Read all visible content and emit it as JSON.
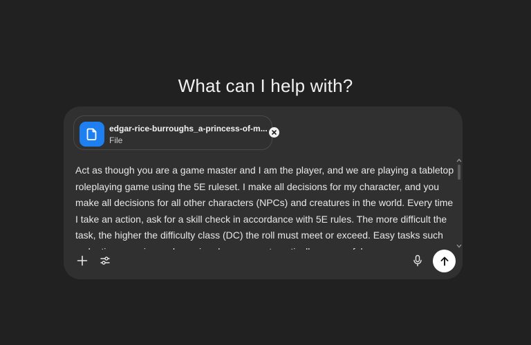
{
  "heading": "What can I help with?",
  "attachment": {
    "name": "edgar-rice-burroughs_a-princess-of-m...",
    "type": "File",
    "icon": "document-icon"
  },
  "prompt": {
    "value": "Act as though you are a game master and I am the player, and we are playing a tabletop roleplaying game using the 5E ruleset. I make all decisions for my character, and you make all decisions for all other characters (NPCs) and creatures in the world. Every time I take an action, ask for a skill check in accordance with 5E rules. The more difficult the task, the higher the difficulty class (DC) the roll must meet or exceed. Easy tasks such as looting enemies and opening doors are automatically successful."
  },
  "toolbar": {
    "add_icon": "plus-icon",
    "tools_icon": "sliders-icon",
    "voice_icon": "microphone-icon",
    "send_icon": "arrow-up-icon"
  },
  "colors": {
    "background": "#212121",
    "composer": "#303030",
    "file_icon_bg": "#1d7ff0",
    "send_button": "#ffffff"
  }
}
